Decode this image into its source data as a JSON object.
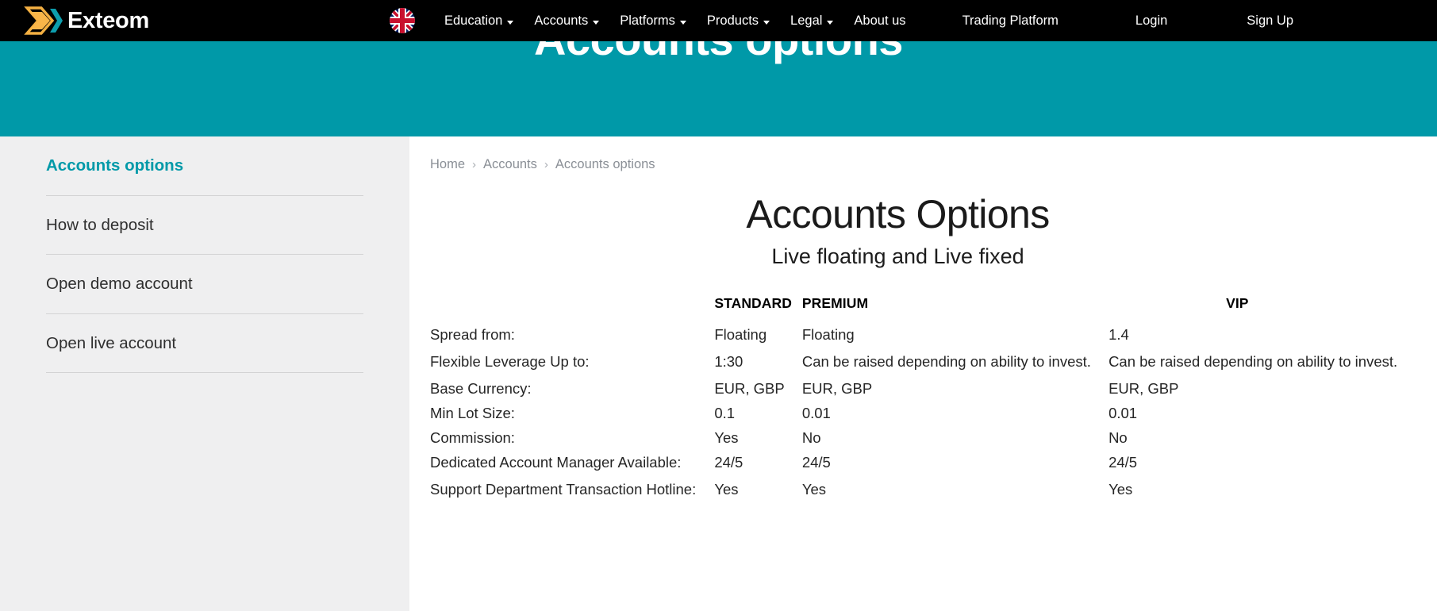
{
  "navbar": {
    "brand": "Exteom",
    "brand_logo_icon": "exteom-double-chevron-logo",
    "brand_logo_colors": {
      "chevron_orange": "#f4b042",
      "chevron_teal": "#0099a8"
    },
    "language_flag_icon": "uk-flag-circle-icon",
    "menu": [
      {
        "label": "Education",
        "has_dropdown": true
      },
      {
        "label": "Accounts",
        "has_dropdown": true
      },
      {
        "label": "Platforms",
        "has_dropdown": true
      },
      {
        "label": "Products",
        "has_dropdown": true
      },
      {
        "label": "Legal",
        "has_dropdown": true
      },
      {
        "label": "About us",
        "has_dropdown": false
      }
    ],
    "trading_platform_label": "Trading Platform",
    "login_label": "Login",
    "signup_label": "Sign Up"
  },
  "hero": {
    "title": "Accounts options",
    "background_color": "#0099a8"
  },
  "sidebar": {
    "items": [
      {
        "label": "Accounts options",
        "active": true
      },
      {
        "label": "How to deposit",
        "active": false
      },
      {
        "label": "Open demo account",
        "active": false
      },
      {
        "label": "Open live account",
        "active": false
      }
    ],
    "active_color": "#0099a8",
    "background_color": "#efeff0"
  },
  "breadcrumb": {
    "separator": "›",
    "items": [
      "Home",
      "Accounts",
      "Accounts options"
    ]
  },
  "main": {
    "title": "Accounts Options",
    "subtitle": "Live floating and Live fixed"
  },
  "table": {
    "headers": [
      "",
      "STANDARD",
      "PREMIUM",
      "VIP"
    ],
    "rows": [
      {
        "label": "Spread from:",
        "standard": "Floating",
        "premium": "Floating",
        "vip": "1.4"
      },
      {
        "label": "Flexible Leverage Up to:",
        "standard": "1:30",
        "premium": "Can be raised depending on ability to invest.",
        "vip": "Can be raised depending on ability to invest."
      },
      {
        "label": "Base Currency:",
        "standard": "EUR, GBP",
        "premium": "EUR, GBP",
        "vip": "EUR, GBP"
      },
      {
        "label": "Min Lot Size:",
        "standard": "0.1",
        "premium": "0.01",
        "vip": "0.01"
      },
      {
        "label": "Commission:",
        "standard": "Yes",
        "premium": "No",
        "vip": "No"
      },
      {
        "label": "Dedicated Account Manager Available:",
        "standard": "24/5",
        "premium": "24/5",
        "vip": "24/5"
      },
      {
        "label": "Support Department Transaction Hotline:",
        "standard": "Yes",
        "premium": "Yes",
        "vip": "Yes"
      }
    ]
  }
}
